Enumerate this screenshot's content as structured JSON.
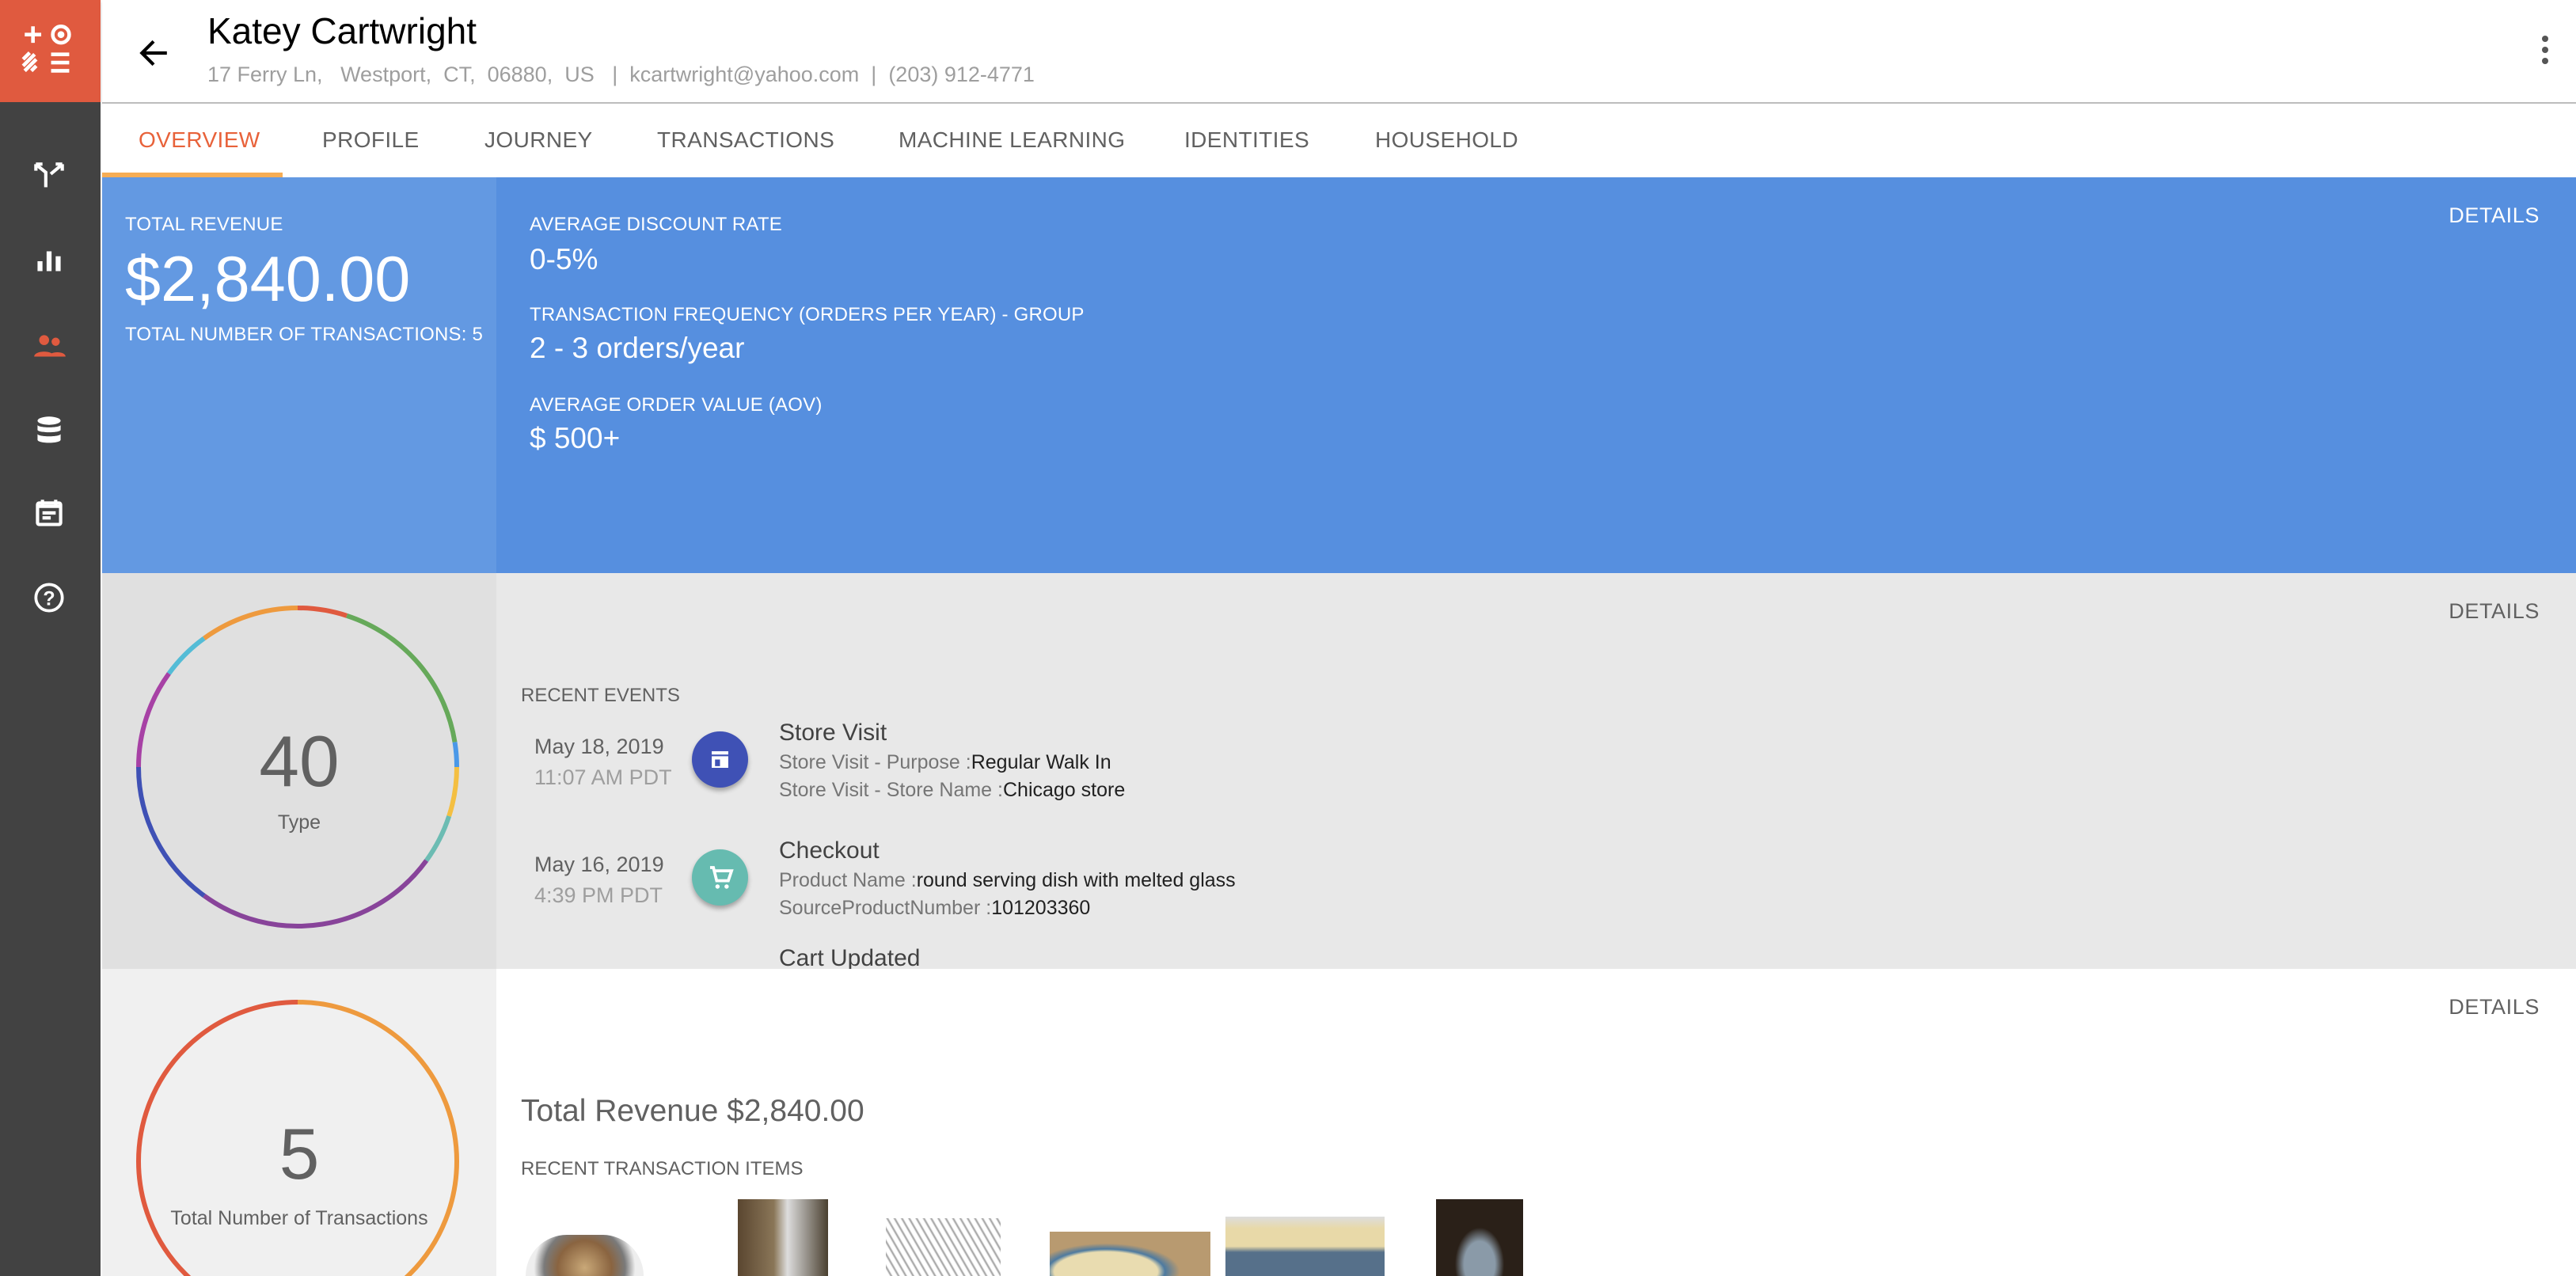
{
  "header": {
    "name": "Katey Cartwright",
    "address": "17 Ferry Ln,   Westport,  CT,  06880,  US",
    "email": "kcartwright@yahoo.com",
    "phone": "(203) 912-4771",
    "separator": "|"
  },
  "sidebar": {
    "items": [
      {
        "icon": "journey-split-icon"
      },
      {
        "icon": "bar-chart-icon"
      },
      {
        "icon": "people-icon",
        "active": true
      },
      {
        "icon": "database-icon"
      },
      {
        "icon": "calendar-icon"
      },
      {
        "icon": "help-icon"
      }
    ]
  },
  "tabs": [
    {
      "label": "OVERVIEW",
      "active": true
    },
    {
      "label": "PROFILE"
    },
    {
      "label": "JOURNEY"
    },
    {
      "label": "TRANSACTIONS"
    },
    {
      "label": "MACHINE LEARNING"
    },
    {
      "label": "IDENTITIES"
    },
    {
      "label": "HOUSEHOLD"
    }
  ],
  "summary": {
    "total_revenue_label": "TOTAL REVENUE",
    "total_revenue": "$2,840.00",
    "total_transactions": "TOTAL NUMBER OF TRANSACTIONS: 5",
    "details": "DETAILS",
    "metrics": [
      {
        "label": "AVERAGE DISCOUNT RATE",
        "value": "0-5%"
      },
      {
        "label": "TRANSACTION FREQUENCY (ORDERS PER YEAR) - GROUP",
        "value": "2 - 3 orders/year"
      },
      {
        "label": "AVERAGE ORDER VALUE (AOV)",
        "value": "$ 500+"
      }
    ]
  },
  "events": {
    "details": "DETAILS",
    "heading": "RECENT EVENTS",
    "items": [
      {
        "date": "May 18, 2019",
        "time": "11:07 AM PDT",
        "title": "Store Visit",
        "icon": "store-icon",
        "color": "#3f51b5",
        "lines": [
          {
            "k": "Store Visit - Purpose :",
            "v": "Regular Walk In"
          },
          {
            "k": "Store Visit - Store Name :",
            "v": "Chicago store"
          }
        ]
      },
      {
        "date": "May 16, 2019",
        "time": "4:39 PM PDT",
        "title": "Checkout",
        "icon": "cart-icon",
        "color": "#66bbb0",
        "lines": [
          {
            "k": "Product Name :",
            "v": "round serving dish with melted glass"
          },
          {
            "k": "SourceProductNumber :",
            "v": "101203360"
          }
        ]
      },
      {
        "title": "Cart Updated"
      }
    ]
  },
  "transactions": {
    "details": "DETAILS",
    "total": "Total Revenue $2,840.00",
    "heading": "RECENT TRANSACTION ITEMS"
  },
  "chart_data": [
    {
      "type": "pie",
      "center_value": "40",
      "center_label": "Type",
      "values": [
        2,
        7,
        1,
        2,
        2,
        10,
        6,
        4,
        2,
        4
      ],
      "colors": [
        "#e05a3f",
        "#66a95a",
        "#4a98e8",
        "#f4bf42",
        "#6cbcb3",
        "#88449a",
        "#3f51b5",
        "#a741a5",
        "#54bcd6",
        "#ee9a3e"
      ]
    },
    {
      "type": "pie",
      "center_value": "5",
      "center_label": "Total Number of Transactions",
      "values": [
        1,
        1
      ],
      "colors": [
        "#ee9a3e",
        "#e05a3f"
      ]
    }
  ],
  "colors": {
    "accent": "#e8623a",
    "sidebar": "#424242",
    "logo": "#e05a3f",
    "blue_left": "#6399e2",
    "blue_right": "#568fdf"
  }
}
